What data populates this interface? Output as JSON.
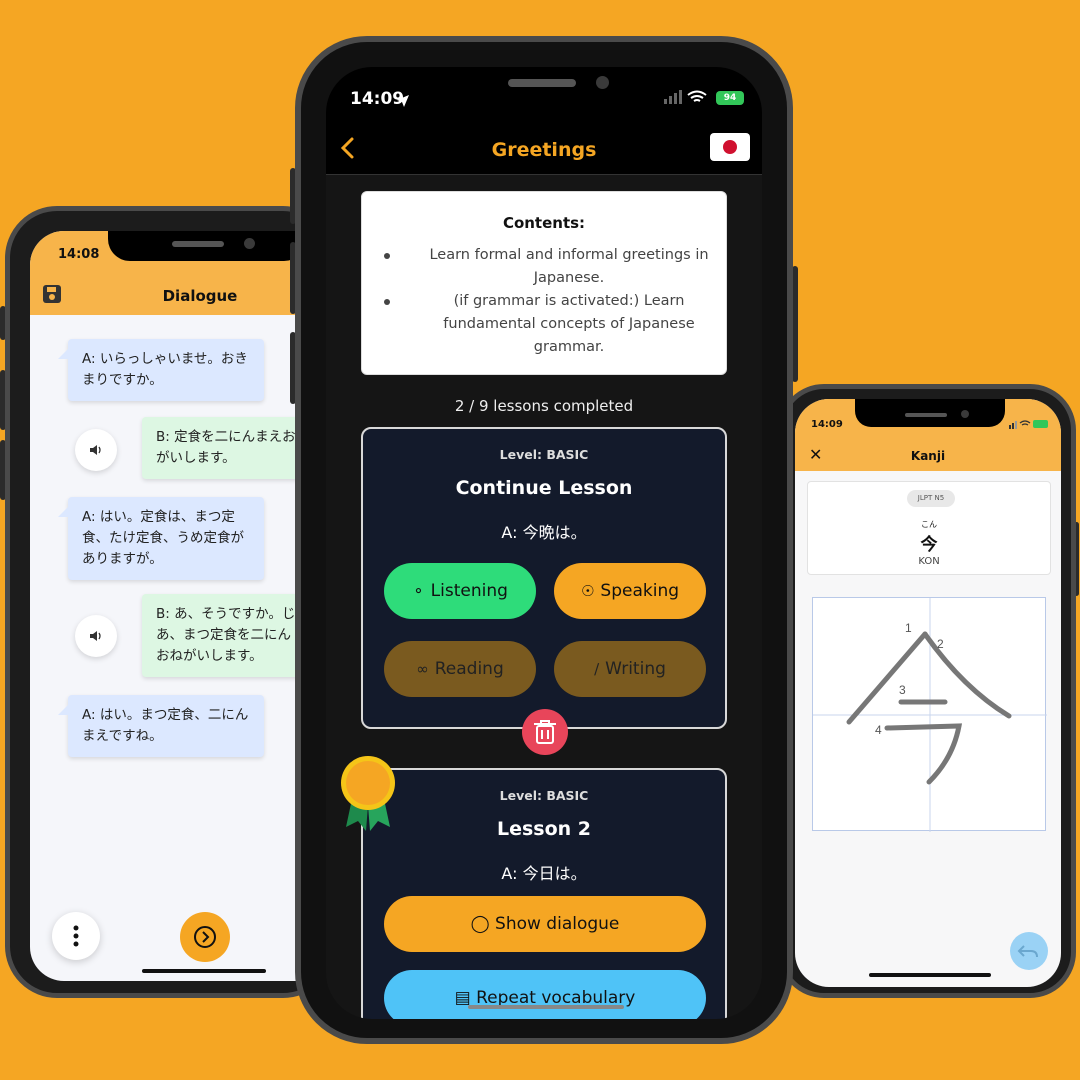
{
  "left_phone": {
    "status_time": "14:08",
    "title": "Dialogue",
    "icons": {
      "save": "save-icon",
      "sound": "speaker-icon",
      "more": "more-vertical-icon",
      "next": "chevron-right-circle-icon"
    },
    "messages": [
      {
        "speaker": "A",
        "text": "A: いらっしゃいませ。おきまりですか。"
      },
      {
        "speaker": "B",
        "text": "B: 定食を二にんまえお\nがいします。"
      },
      {
        "speaker": "A",
        "text": "A: はい。定食は、まつ定食、たけ定食、うめ定食がありますが。"
      },
      {
        "speaker": "B",
        "text": "B: あ、そうですか。じ\nあ、まつ定食を二にん\nおねがいします。"
      },
      {
        "speaker": "A",
        "text": "A: はい。まつ定食、二にんまえですね。"
      }
    ]
  },
  "center_phone": {
    "status_time": "14:09",
    "battery": "94",
    "title": "Greetings",
    "icons": {
      "back": "chevron-left-icon",
      "flag": "japan-flag-icon",
      "trash": "trash-icon",
      "medal": "medal-icon"
    },
    "contents": {
      "title": "Contents:",
      "items": [
        "Learn formal and informal greetings in Japanese.",
        "(if grammar is activated:) Learn fundamental concepts of Japanese grammar."
      ]
    },
    "progress": "2 / 9 lessons completed",
    "lessons": [
      {
        "level": "Level: BASIC",
        "name": "Continue Lesson",
        "phrase": "A: 今晩は。",
        "buttons": {
          "listening": "Listening",
          "speaking": "Speaking",
          "reading": "Reading",
          "writing": "Writing"
        }
      },
      {
        "level": "Level: BASIC",
        "name": "Lesson 2",
        "phrase": "A: 今日は。",
        "buttons": {
          "show_dialogue": "Show dialogue",
          "repeat_vocabulary": "Repeat vocabulary"
        }
      }
    ],
    "colors": {
      "accent": "#F5A623",
      "listening": "#2EDC7A",
      "speaking": "#F5A623",
      "locked": "#7A5A1F",
      "vocab": "#4FC3F7",
      "trash": "#E8455A"
    }
  },
  "right_phone": {
    "status_time": "14:09",
    "battery": "94",
    "title": "Kanji",
    "close": "✕",
    "badge": "JLPT N5",
    "furigana": "こん",
    "kanji": "今",
    "reading": "KON",
    "stroke_numbers": [
      "1",
      "2",
      "3",
      "4"
    ],
    "icons": {
      "undo": "undo-icon"
    }
  }
}
